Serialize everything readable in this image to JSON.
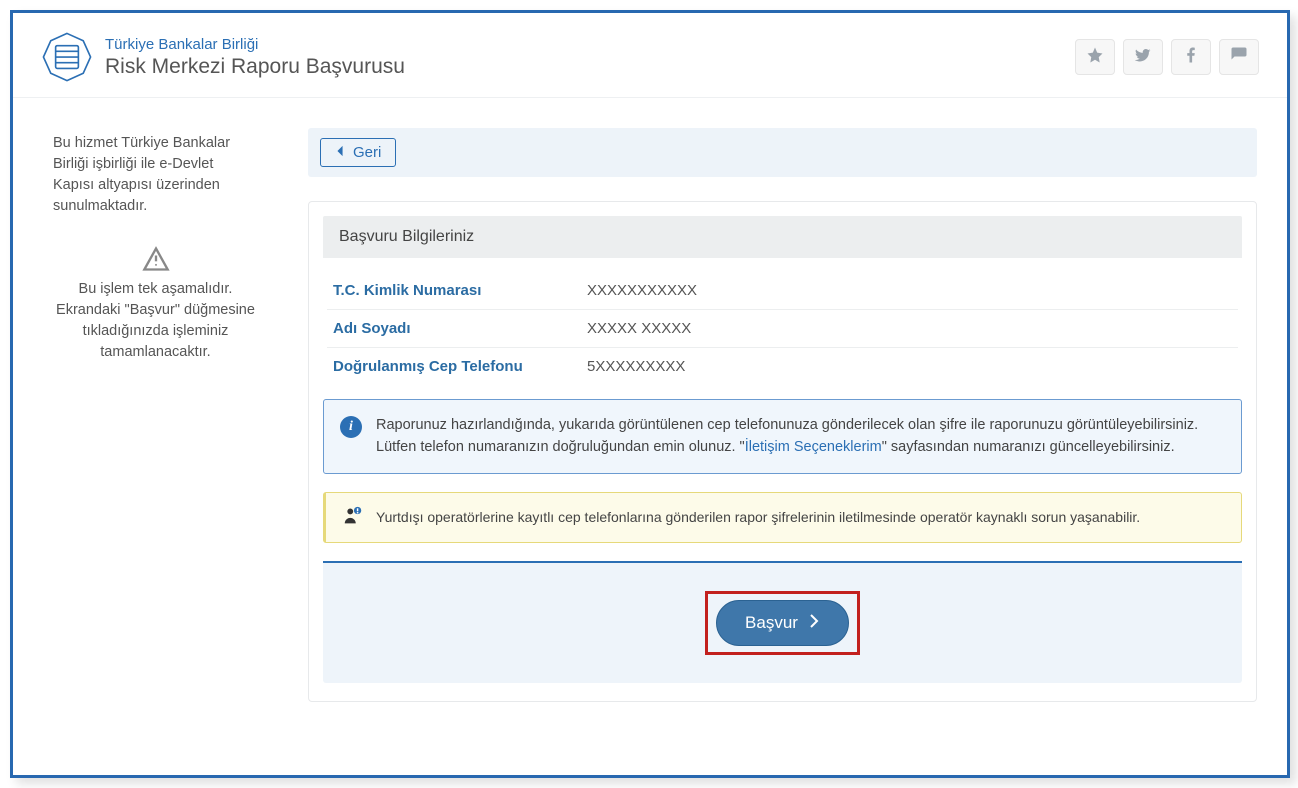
{
  "header": {
    "org": "Türkiye Bankalar Birliği",
    "title": "Risk Merkezi Raporu Başvurusu"
  },
  "social": {
    "star": "star-icon",
    "twitter": "twitter-icon",
    "facebook": "facebook-icon",
    "comment": "comment-icon"
  },
  "sidebar": {
    "info1": "Bu hizmet Türkiye Bankalar Birliği işbirliği ile e-Devlet Kapısı altyapısı üzerinden sunulmaktadır.",
    "info2": "Bu işlem tek aşamalıdır. Ekrandaki \"Başvur\" düğmesine tıkladığınızda işleminiz tamamlanacaktır."
  },
  "nav": {
    "back_label": "Geri"
  },
  "section": {
    "heading": "Başvuru Bilgileriniz",
    "rows": [
      {
        "label": "T.C. Kimlik Numarası",
        "value": "XXXXXXXXXXX"
      },
      {
        "label": "Adı Soyadı",
        "value": "XXXXX XXXXX"
      },
      {
        "label": "Doğrulanmış Cep Telefonu",
        "value": "5XXXXXXXXX"
      }
    ]
  },
  "alerts": {
    "info_prefix": "Raporunuz hazırlandığında, yukarıda görüntülenen cep telefonunuza gönderilecek olan şifre ile raporunuzu görüntüleyebilirsiniz. Lütfen telefon numaranızın doğruluğundan emin olunuz. \"",
    "info_link": "İletişim Seçeneklerim",
    "info_suffix": "\" sayfasından numaranızı güncelleyebilirsiniz.",
    "warning": "Yurtdışı operatörlerine kayıtlı cep telefonlarına gönderilen rapor şifrelerinin iletilmesinde operatör kaynaklı sorun yaşanabilir."
  },
  "action": {
    "submit_label": "Başvur"
  }
}
